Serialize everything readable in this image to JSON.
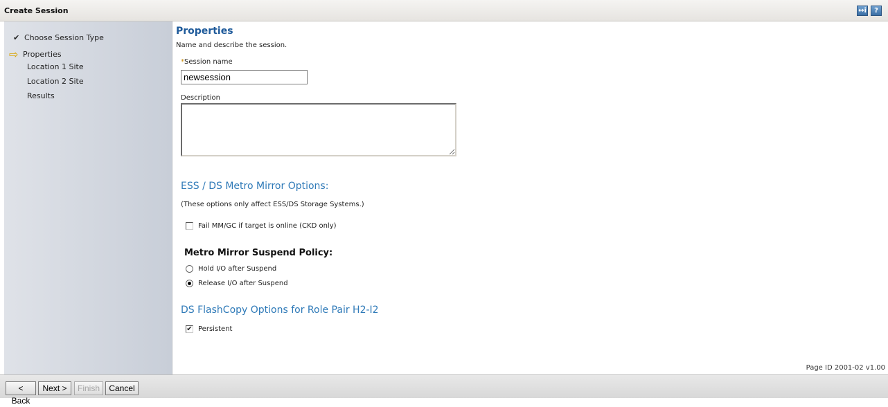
{
  "window": {
    "title": "Create Session"
  },
  "toolbar": {
    "restore_label": "↔i",
    "help_label": "?"
  },
  "nav": {
    "items": [
      {
        "label": "Choose Session Type",
        "mark": "✔"
      },
      {
        "label": "Properties",
        "mark": "⇨"
      },
      {
        "label": "Location 1 Site",
        "mark": ""
      },
      {
        "label": "Location 2 Site",
        "mark": ""
      },
      {
        "label": "Results",
        "mark": ""
      }
    ]
  },
  "main": {
    "title": "Properties",
    "subtitle": "Name and describe the session.",
    "session_name_required": "*",
    "session_name_label": "Session name",
    "session_name_value": "newsession",
    "description_label": "Description",
    "description_value": "",
    "mm_section_title": "ESS / DS Metro Mirror Options:",
    "mm_note": "(These options only affect ESS/DS Storage Systems.)",
    "fail_mm_label": "Fail MM/GC if target is online (CKD only)",
    "fail_mm_checked": false,
    "policy_title": "Metro Mirror Suspend Policy:",
    "policy_options": [
      {
        "label": "Hold I/O after Suspend",
        "selected": false
      },
      {
        "label": "Release I/O after Suspend",
        "selected": true
      }
    ],
    "flash_section_title": "DS FlashCopy Options for Role Pair H2-I2",
    "persistent_label": "Persistent",
    "persistent_checked": true,
    "page_id": "Page ID 2001-02 v1.00"
  },
  "buttons": {
    "back": "< Back",
    "next": "Next >",
    "finish": "Finish",
    "cancel": "Cancel"
  }
}
